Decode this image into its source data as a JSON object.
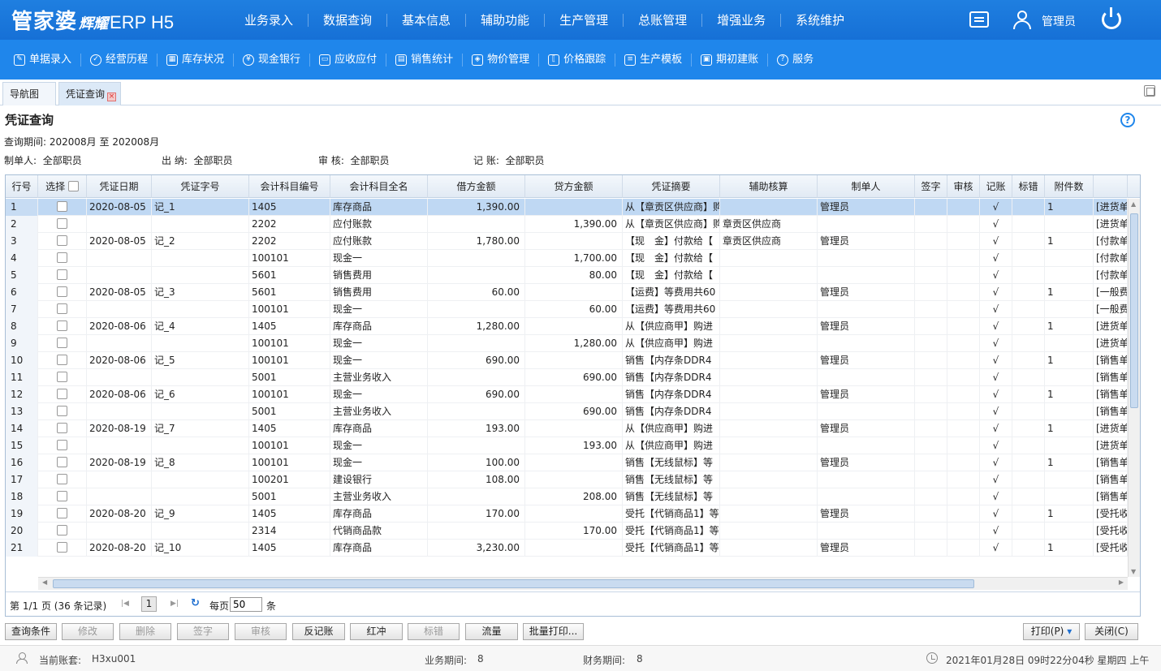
{
  "header": {
    "logo_main": "管家婆",
    "logo_sub": "辉耀",
    "logo_erp": "ERP H5",
    "nav": [
      "业务录入",
      "数据查询",
      "基本信息",
      "辅助功能",
      "生产管理",
      "总账管理",
      "增强业务",
      "系统维护"
    ],
    "user": "管理员"
  },
  "toolbar": {
    "items": [
      {
        "label": "单据录入",
        "icon": "edit-icon"
      },
      {
        "label": "经营历程",
        "icon": "check-circle-icon"
      },
      {
        "label": "库存状况",
        "icon": "calendar-icon"
      },
      {
        "label": "现金银行",
        "icon": "yen-circle-icon"
      },
      {
        "label": "应收应付",
        "icon": "window-icon"
      },
      {
        "label": "销售统计",
        "icon": "chart-icon"
      },
      {
        "label": "物价管理",
        "icon": "shield-icon"
      },
      {
        "label": "价格跟踪",
        "icon": "brackets-icon"
      },
      {
        "label": "生产模板",
        "icon": "list-icon"
      },
      {
        "label": "期初建账",
        "icon": "book-icon"
      },
      {
        "label": "服务",
        "icon": "question-circle-icon"
      }
    ]
  },
  "tabs": [
    {
      "label": "导航图"
    },
    {
      "label": "凭证查询",
      "closable": true
    }
  ],
  "page": {
    "title": "凭证查询",
    "period_label": "查询期间:",
    "period_value": "202008月 至 202008月",
    "filters": [
      {
        "label": "制单人:",
        "value": "全部职员"
      },
      {
        "label": "出 纳:",
        "value": "全部职员"
      },
      {
        "label": "审 核:",
        "value": "全部职员"
      },
      {
        "label": "记 账:",
        "value": "全部职员"
      }
    ]
  },
  "table": {
    "columns": [
      "行号",
      "选择",
      "凭证日期",
      "凭证字号",
      "会计科目编号",
      "会计科目全名",
      "借方金额",
      "贷方金额",
      "凭证摘要",
      "辅助核算",
      "制单人",
      "签字",
      "审核",
      "记账",
      "标错",
      "附件数",
      ""
    ],
    "rows": [
      [
        "1",
        "2020-08-05",
        "记_1",
        "1405",
        "库存商品",
        "1,390.00",
        "",
        "从【章贡区供应商】购",
        "",
        "管理员",
        "",
        "",
        "√",
        "",
        "1",
        "[进货单"
      ],
      [
        "2",
        "",
        "",
        "2202",
        "应付账款",
        "",
        "1,390.00",
        "从【章贡区供应商】购",
        "章贡区供应商",
        "",
        "",
        "",
        "√",
        "",
        "",
        "[进货单"
      ],
      [
        "3",
        "2020-08-05",
        "记_2",
        "2202",
        "应付账款",
        "1,780.00",
        "",
        "【现　金】付款给【",
        "章贡区供应商",
        "管理员",
        "",
        "",
        "√",
        "",
        "1",
        "[付款单"
      ],
      [
        "4",
        "",
        "",
        "100101",
        "现金一",
        "",
        "1,700.00",
        "【现　金】付款给【",
        "",
        "",
        "",
        "",
        "√",
        "",
        "",
        "[付款单"
      ],
      [
        "5",
        "",
        "",
        "5601",
        "销售费用",
        "",
        "80.00",
        "【现　金】付款给【",
        "",
        "",
        "",
        "",
        "√",
        "",
        "",
        "[付款单"
      ],
      [
        "6",
        "2020-08-05",
        "记_3",
        "5601",
        "销售费用",
        "60.00",
        "",
        "【运费】等费用共60",
        "",
        "管理员",
        "",
        "",
        "√",
        "",
        "1",
        "[一般费"
      ],
      [
        "7",
        "",
        "",
        "100101",
        "现金一",
        "",
        "60.00",
        "【运费】等费用共60",
        "",
        "",
        "",
        "",
        "√",
        "",
        "",
        "[一般费"
      ],
      [
        "8",
        "2020-08-06",
        "记_4",
        "1405",
        "库存商品",
        "1,280.00",
        "",
        "从【供应商甲】购进",
        "",
        "管理员",
        "",
        "",
        "√",
        "",
        "1",
        "[进货单"
      ],
      [
        "9",
        "",
        "",
        "100101",
        "现金一",
        "",
        "1,280.00",
        "从【供应商甲】购进",
        "",
        "",
        "",
        "",
        "√",
        "",
        "",
        "[进货单"
      ],
      [
        "10",
        "2020-08-06",
        "记_5",
        "100101",
        "现金一",
        "690.00",
        "",
        "销售【内存条DDR4",
        "",
        "管理员",
        "",
        "",
        "√",
        "",
        "1",
        "[销售单"
      ],
      [
        "11",
        "",
        "",
        "5001",
        "主营业务收入",
        "",
        "690.00",
        "销售【内存条DDR4",
        "",
        "",
        "",
        "",
        "√",
        "",
        "",
        "[销售单"
      ],
      [
        "12",
        "2020-08-06",
        "记_6",
        "100101",
        "现金一",
        "690.00",
        "",
        "销售【内存条DDR4",
        "",
        "管理员",
        "",
        "",
        "√",
        "",
        "1",
        "[销售单"
      ],
      [
        "13",
        "",
        "",
        "5001",
        "主营业务收入",
        "",
        "690.00",
        "销售【内存条DDR4",
        "",
        "",
        "",
        "",
        "√",
        "",
        "",
        "[销售单"
      ],
      [
        "14",
        "2020-08-19",
        "记_7",
        "1405",
        "库存商品",
        "193.00",
        "",
        "从【供应商甲】购进",
        "",
        "管理员",
        "",
        "",
        "√",
        "",
        "1",
        "[进货单"
      ],
      [
        "15",
        "",
        "",
        "100101",
        "现金一",
        "",
        "193.00",
        "从【供应商甲】购进",
        "",
        "",
        "",
        "",
        "√",
        "",
        "",
        "[进货单"
      ],
      [
        "16",
        "2020-08-19",
        "记_8",
        "100101",
        "现金一",
        "100.00",
        "",
        "销售【无线鼠标】等",
        "",
        "管理员",
        "",
        "",
        "√",
        "",
        "1",
        "[销售单"
      ],
      [
        "17",
        "",
        "",
        "100201",
        "建设银行",
        "108.00",
        "",
        "销售【无线鼠标】等",
        "",
        "",
        "",
        "",
        "√",
        "",
        "",
        "[销售单"
      ],
      [
        "18",
        "",
        "",
        "5001",
        "主营业务收入",
        "",
        "208.00",
        "销售【无线鼠标】等",
        "",
        "",
        "",
        "",
        "√",
        "",
        "",
        "[销售单"
      ],
      [
        "19",
        "2020-08-20",
        "记_9",
        "1405",
        "库存商品",
        "170.00",
        "",
        "受托【代销商品1】等",
        "",
        "管理员",
        "",
        "",
        "√",
        "",
        "1",
        "[受托收"
      ],
      [
        "20",
        "",
        "",
        "2314",
        "代销商品款",
        "",
        "170.00",
        "受托【代销商品1】等",
        "",
        "",
        "",
        "",
        "√",
        "",
        "",
        "[受托收"
      ],
      [
        "21",
        "2020-08-20",
        "记_10",
        "1405",
        "库存商品",
        "3,230.00",
        "",
        "受托【代销商品1】等",
        "",
        "管理员",
        "",
        "",
        "√",
        "",
        "1",
        "[受托收"
      ]
    ]
  },
  "pager": {
    "info": "第 1/1 页 (36 条记录)",
    "page": "1",
    "per_page_label": "每页",
    "per_page_value": "50",
    "unit": "条"
  },
  "buttons": [
    {
      "label": "查询条件",
      "enabled": true
    },
    {
      "label": "修改",
      "enabled": false
    },
    {
      "label": "删除",
      "enabled": false
    },
    {
      "label": "签字",
      "enabled": false
    },
    {
      "label": "审核",
      "enabled": false
    },
    {
      "label": "反记账",
      "enabled": true
    },
    {
      "label": "红冲",
      "enabled": true
    },
    {
      "label": "标错",
      "enabled": false
    },
    {
      "label": "流量",
      "enabled": true
    },
    {
      "label": "批量打印...",
      "enabled": true
    },
    {
      "label": "打印(P)",
      "enabled": true
    },
    {
      "label": "关闭(C)",
      "enabled": true
    }
  ],
  "status": {
    "account_label": "当前账套:",
    "account_value": "H3xu001",
    "biz_period_label": "业务期间:",
    "biz_period_value": "8",
    "fin_period_label": "财务期间:",
    "fin_period_value": "8",
    "datetime": "2021年01月28日 09时22分04秒 星期四 上午"
  }
}
